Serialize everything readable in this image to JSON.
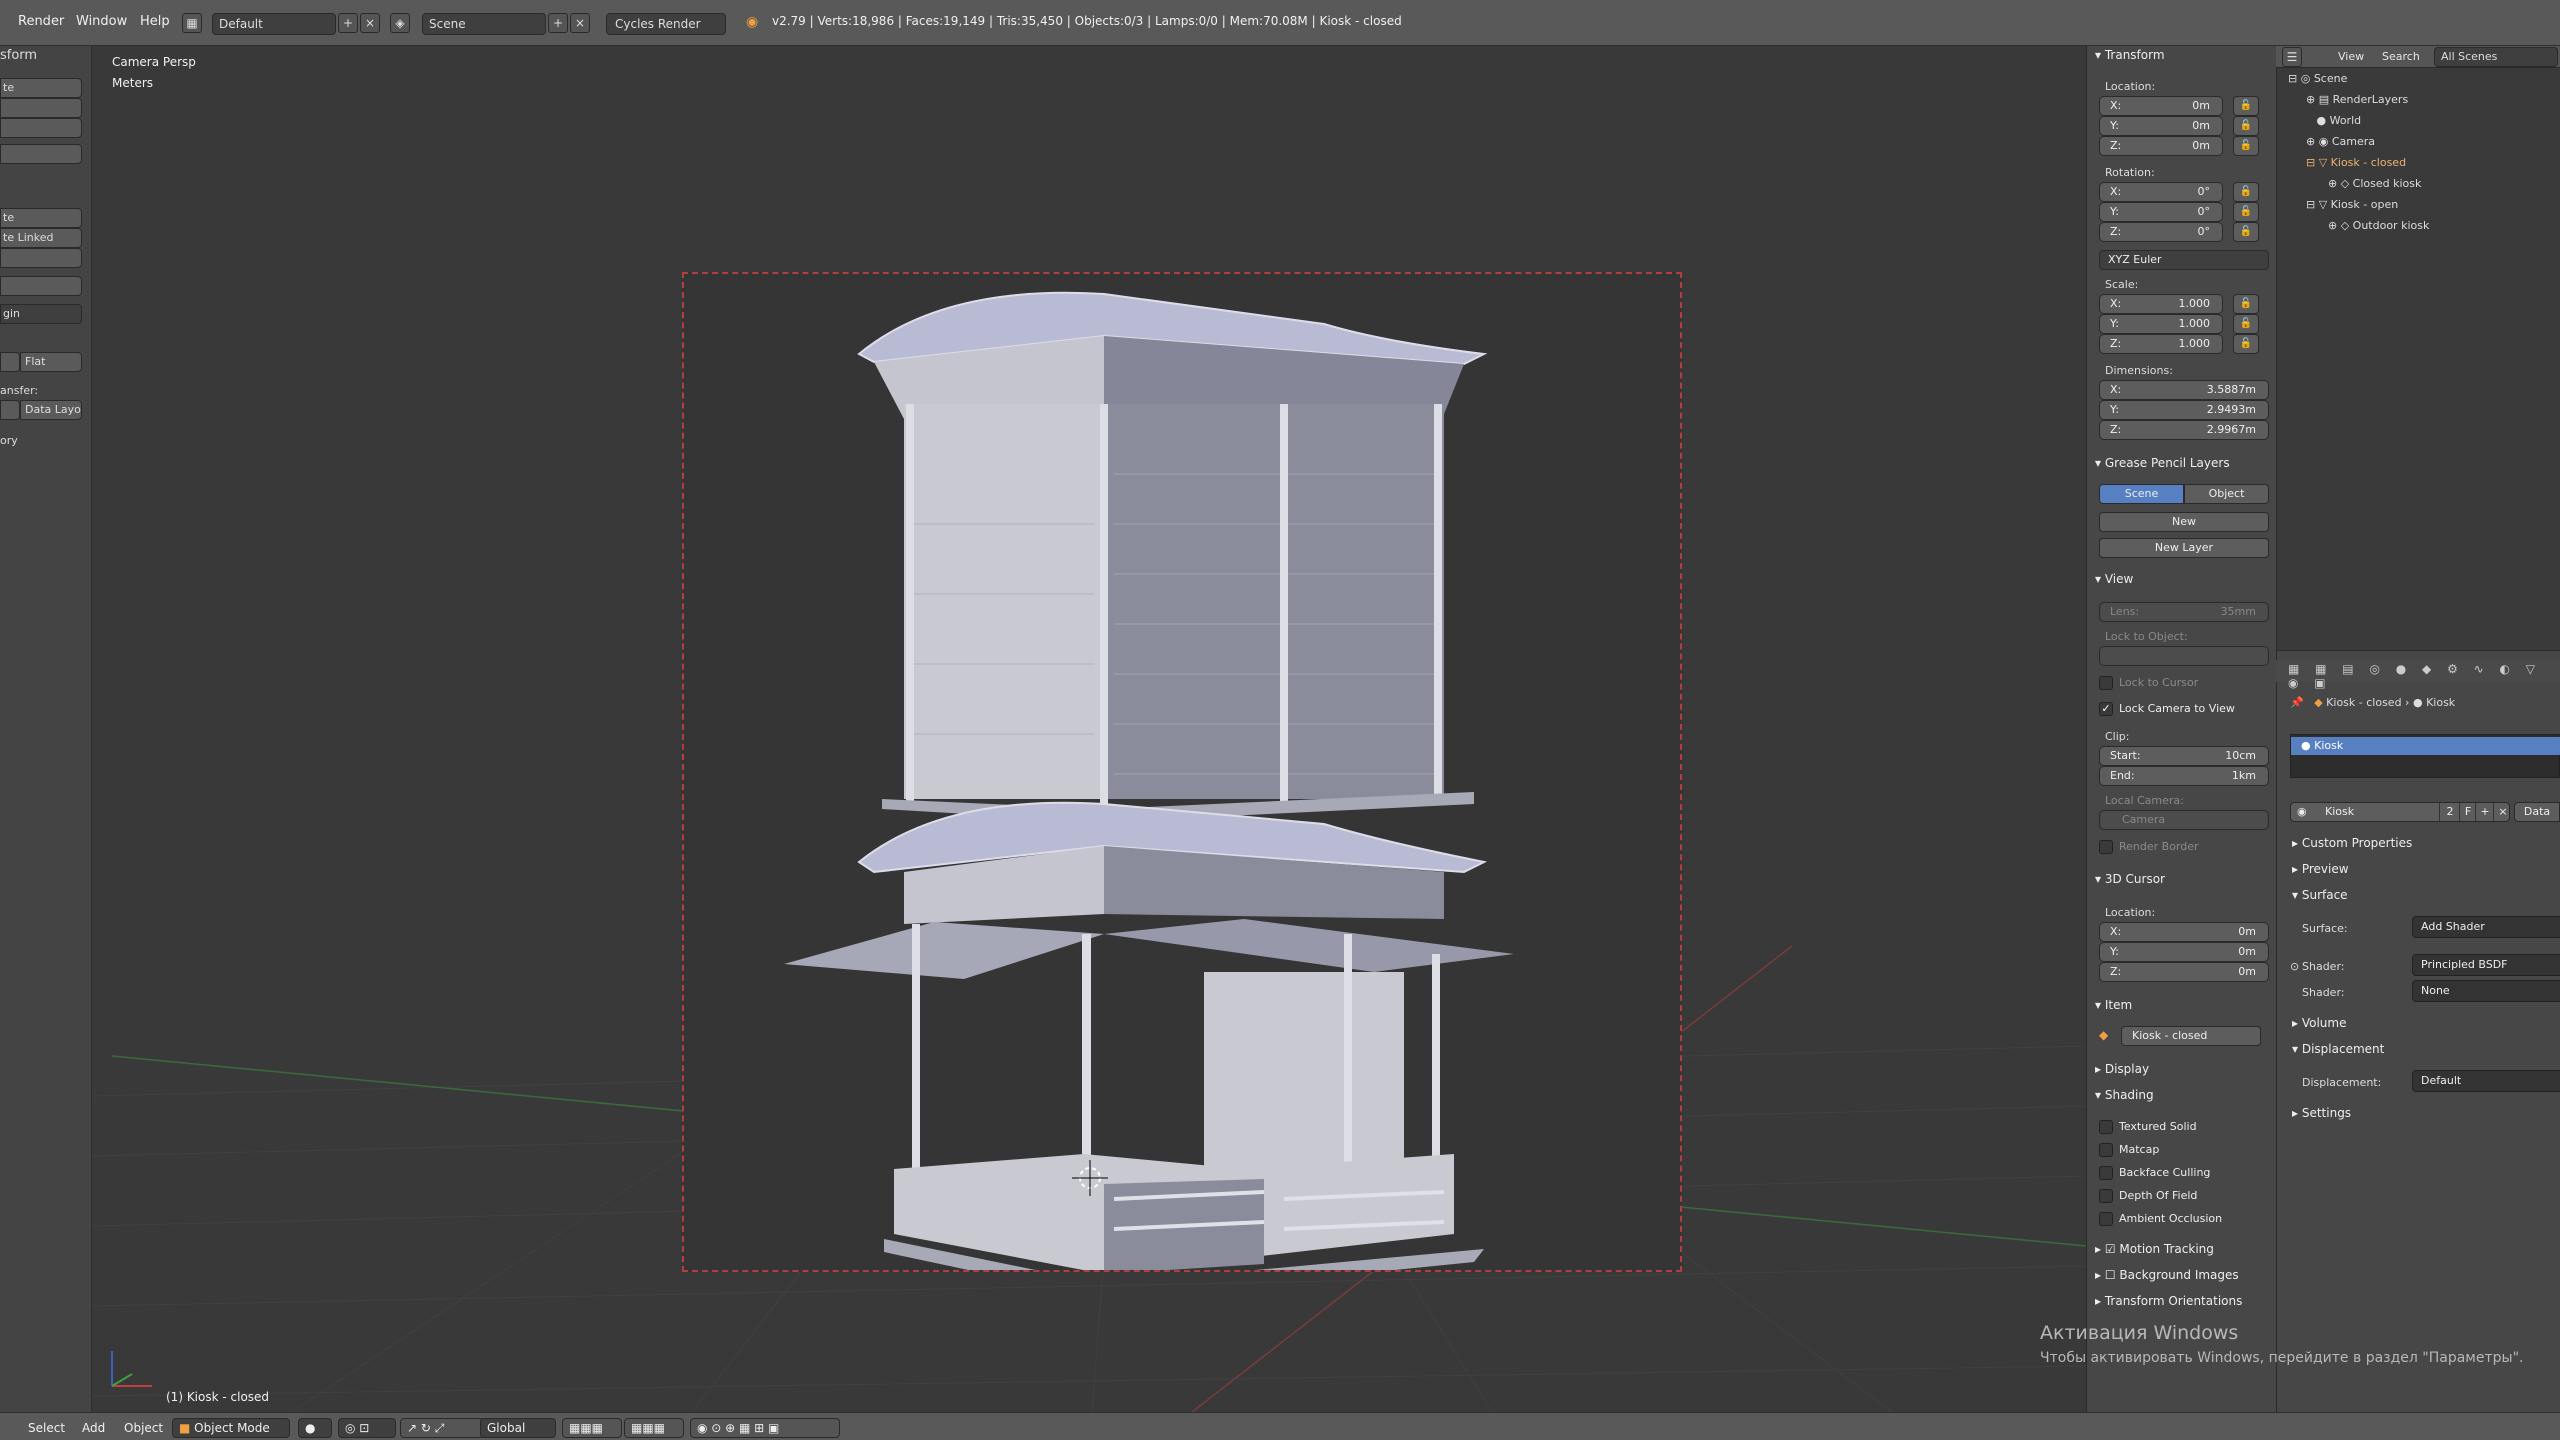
{
  "topbar": {
    "menus": [
      "Render",
      "Window",
      "Help"
    ],
    "layout_name": "Default",
    "scene_name": "Scene",
    "render_engine": "Cycles Render",
    "stats": "v2.79 | Verts:18,986 | Faces:19,149 | Tris:35,450 | Objects:0/3 | Lamps:0/0 | Mem:70.08M | Kiosk - closed"
  },
  "toolshelf": {
    "title": "sform",
    "button_1": "te",
    "button_2": "te",
    "button_3": "te Linked",
    "dropdown": "gin",
    "flat_button": "Flat",
    "transfer_label": "ansfer:",
    "data_layo": "Data Layo",
    "history": "ory"
  },
  "viewport": {
    "view_name": "Camera Persp",
    "units": "Meters",
    "active_object_label": "(1) Kiosk - closed"
  },
  "npanel": {
    "transform_header": "Transform",
    "location_label": "Location:",
    "location": {
      "x": "0m",
      "y": "0m",
      "z": "0m"
    },
    "rotation_label": "Rotation:",
    "rotation": {
      "x": "0°",
      "y": "0°",
      "z": "0°"
    },
    "rotation_mode": "XYZ Euler",
    "scale_label": "Scale:",
    "scale": {
      "x": "1.000",
      "y": "1.000",
      "z": "1.000"
    },
    "dimensions_label": "Dimensions:",
    "dimensions": {
      "x": "3.5887m",
      "y": "2.9493m",
      "z": "2.9967m"
    },
    "axis_x": "X:",
    "axis_y": "Y:",
    "axis_z": "Z:",
    "grease_pencil_header": "Grease Pencil Layers",
    "gp_tab_scene": "Scene",
    "gp_tab_object": "Object",
    "gp_new": "New",
    "gp_new_layer": "New Layer",
    "view_header": "View",
    "lens_label": "Lens:",
    "lens_value": "35mm",
    "lock_to_object": "Lock to Object:",
    "lock_to_cursor": "Lock to Cursor",
    "lock_camera_to_view": "Lock Camera to View",
    "clip_label": "Clip:",
    "clip_start_label": "Start:",
    "clip_start": "10cm",
    "clip_end_label": "End:",
    "clip_end": "1km",
    "local_camera": "Local Camera:",
    "camera_field": "Camera",
    "render_border": "Render Border",
    "cursor_header": "3D Cursor",
    "cursor_location": {
      "x": "0m",
      "y": "0m",
      "z": "0m"
    },
    "item_header": "Item",
    "item_name": "Kiosk - closed",
    "display_header": "Display",
    "shading_header": "Shading",
    "shading_options": [
      "Textured Solid",
      "Matcap",
      "Backface Culling",
      "Depth Of Field",
      "Ambient Occlusion"
    ],
    "motion_tracking": "Motion Tracking",
    "background_images": "Background Images",
    "transform_orientations": "Transform Orientations"
  },
  "outliner": {
    "view_menu": "View",
    "search_menu": "Search",
    "display_mode": "All Scenes",
    "items": [
      {
        "label": "Scene",
        "depth": 0
      },
      {
        "label": "RenderLayers",
        "depth": 1
      },
      {
        "label": "World",
        "depth": 1
      },
      {
        "label": "Camera",
        "depth": 1
      },
      {
        "label": "Kiosk - closed",
        "depth": 1,
        "selected": true
      },
      {
        "label": "Closed kiosk",
        "depth": 2
      },
      {
        "label": "Kiosk - open",
        "depth": 1
      },
      {
        "label": "Outdoor kiosk",
        "depth": 2
      }
    ]
  },
  "properties": {
    "breadcrumb_object": "Kiosk - closed",
    "breadcrumb_material": "Kiosk",
    "slot_name": "Kiosk",
    "material_name": "Kiosk",
    "material_users": "2",
    "fake_user": "F",
    "data_button": "Data",
    "sections": {
      "custom_properties": "Custom Properties",
      "preview": "Preview",
      "surface": "Surface",
      "volume": "Volume",
      "displacement": "Displacement",
      "settings": "Settings"
    },
    "surface_label": "Surface:",
    "surface_value": "Add Shader",
    "shader_label": "Shader:",
    "shader1_value": "Principled BSDF",
    "shader2_value": "None",
    "displacement_label": "Displacement:",
    "displacement_value": "Default"
  },
  "bottombar": {
    "menus": [
      "Select",
      "Add",
      "Object"
    ],
    "mode": "Object Mode",
    "orientation": "Global"
  },
  "watermark": {
    "line1": "Активация Windows",
    "line2": "Чтобы активировать Windows, перейдите в раздел \"Параметры\"."
  },
  "colors": {
    "active_tab": "#5680c2",
    "selected_object": "#f0b070",
    "camera_frame": "#b04040",
    "model": "#a9abc4"
  }
}
